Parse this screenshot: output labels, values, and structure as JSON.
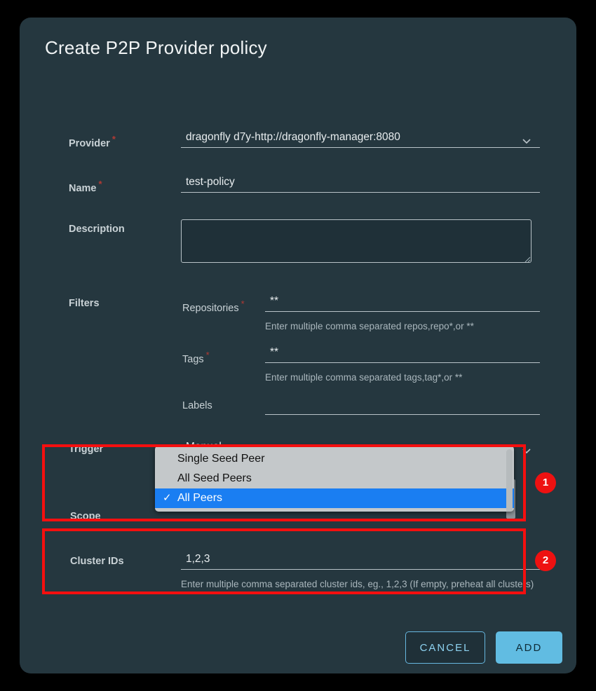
{
  "dialog": {
    "title": "Create P2P Provider policy"
  },
  "fields": {
    "provider": {
      "label": "Provider",
      "required": true,
      "value": "dragonfly d7y-http://dragonfly-manager:8080",
      "icon": "chevron-down-icon"
    },
    "name": {
      "label": "Name",
      "required": true,
      "value": "test-policy",
      "placeholder": ""
    },
    "description": {
      "label": "Description",
      "required": false,
      "value": "",
      "placeholder": ""
    },
    "filters": {
      "label": "Filters",
      "repositories": {
        "label": "Repositories",
        "required": true,
        "value": "**",
        "hint": "Enter multiple comma separated repos,repo*,or **"
      },
      "tags": {
        "label": "Tags",
        "required": true,
        "value": "**",
        "hint": "Enter multiple comma separated tags,tag*,or **"
      },
      "labels": {
        "label": "Labels",
        "required": false,
        "value": "",
        "hint": ""
      }
    },
    "trigger": {
      "label": "Trigger",
      "required": false,
      "value": "Manual",
      "icon": "chevron-down-icon"
    },
    "scope": {
      "label": "Scope",
      "required": false,
      "selected": "All Peers",
      "options": [
        {
          "label": "Single Seed Peer",
          "selected": false
        },
        {
          "label": "All Seed Peers",
          "selected": false
        },
        {
          "label": "All Peers",
          "selected": true
        }
      ],
      "check_glyph": "✓"
    },
    "cluster_ids": {
      "label": "Cluster IDs",
      "required": false,
      "value": "1,2,3",
      "hint": "Enter multiple comma separated cluster ids, eg., 1,2,3 (If empty, preheat all clusters)"
    }
  },
  "actions": {
    "cancel_label": "CANCEL",
    "add_label": "ADD"
  },
  "annotations": [
    {
      "number": "1",
      "target": "scope"
    },
    {
      "number": "2",
      "target": "cluster-ids"
    }
  ],
  "colors": {
    "card_bg": "#25373f",
    "page_bg": "#000000",
    "accent": "#61bce2",
    "annotation_red": "#f50f0f",
    "required_red": "#b23a34",
    "menu_highlight": "#1a7ef2",
    "menu_bg": "#c4c8ca"
  }
}
